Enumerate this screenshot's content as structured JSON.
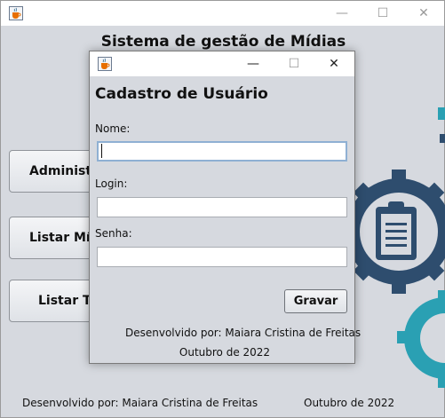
{
  "main": {
    "app_title": "Sistema de gestão de Mídias",
    "buttons": [
      "Administrar",
      "Listar Mídias",
      "Listar Ta"
    ],
    "footer_credit": "Desenvolvido por: Maiara Cristina de Freitas",
    "footer_date": "Outubro de 2022",
    "controls": {
      "minimize": "—",
      "maximize": "☐",
      "close": "✕"
    }
  },
  "dialog": {
    "heading": "Cadastro de Usuário",
    "fields": [
      {
        "label": "Nome:",
        "value": ""
      },
      {
        "label": "Login:",
        "value": ""
      },
      {
        "label": "Senha:",
        "value": ""
      }
    ],
    "save_label": "Gravar",
    "credit": "Desenvolvido por: Maiara Cristina de Freitas",
    "date": "Outubro de 2022",
    "controls": {
      "minimize": "—",
      "maximize": "☐",
      "close": "✕"
    }
  },
  "colors": {
    "window_bg": "#d6d9df",
    "gear_dark": "#2e4d6e",
    "gear_teal": "#2aa0b3",
    "focus_border": "#8fb0d3"
  },
  "icons": [
    "java-cup-icon",
    "clipboard-icon",
    "gear-icon"
  ]
}
